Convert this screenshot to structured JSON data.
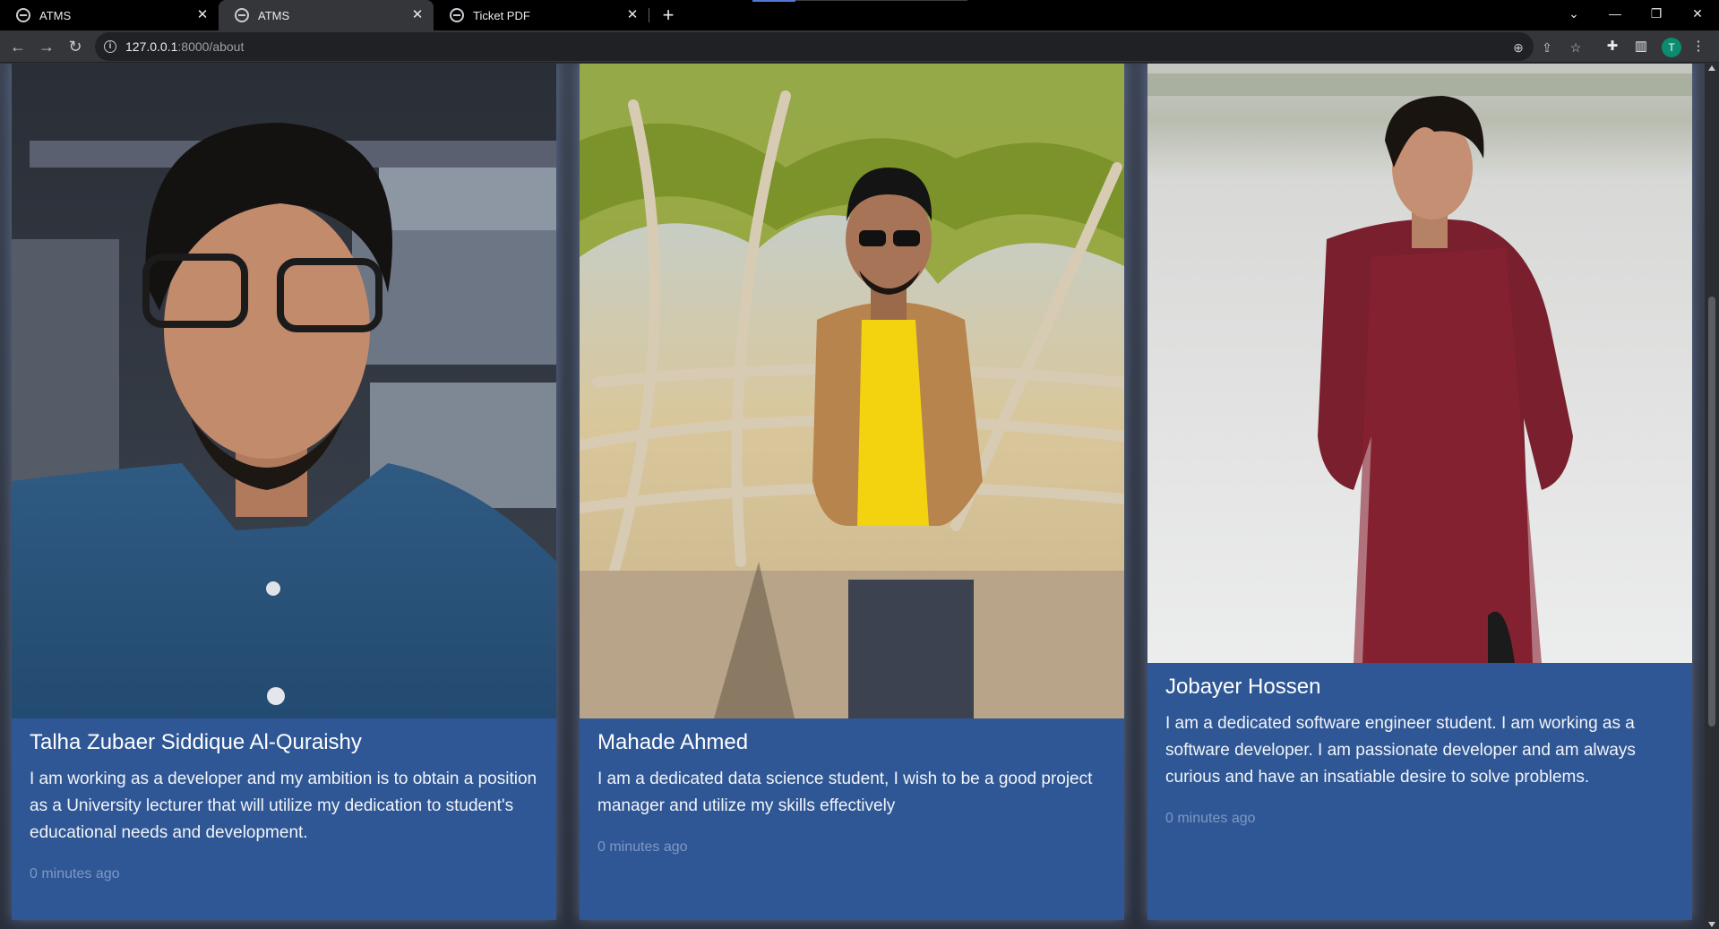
{
  "browser": {
    "tabs": [
      {
        "title": "ATMS",
        "active": false
      },
      {
        "title": "ATMS",
        "active": true
      },
      {
        "title": "Ticket PDF",
        "active": false
      }
    ],
    "new_tab_symbol": "+",
    "address": {
      "host": "127.0.0.1",
      "rest": ":8000/about"
    },
    "profile_initial": "T",
    "icons": [
      "back-icon",
      "forward-icon",
      "reload-icon",
      "info-icon",
      "zoom-icon",
      "share-icon",
      "star-icon",
      "extensions-icon",
      "side-panel-icon",
      "menu-icon",
      "tab-search-icon",
      "minimize-icon",
      "restore-icon",
      "close-icon"
    ]
  },
  "team": [
    {
      "name": "Talha Zubaer Siddique Al-Quraishy",
      "description": "I am working as a developer and my ambition is to obtain a position as a University lecturer that will utilize my dedication to student's educational needs and development.",
      "time": "0 minutes ago",
      "photo": "portrait-glasses-blue-shirt"
    },
    {
      "name": "Mahade Ahmed",
      "description": "I am a dedicated data science student, I wish to be a good project manager and utilize my skills effectively",
      "time": "0 minutes ago",
      "photo": "portrait-mangrove-forest"
    },
    {
      "name": "Jobayer Hossen",
      "description": "I am a dedicated software engineer student. I am working as a software developer. I am passionate developer and am always curious and have an insatiable desire to solve problems.",
      "time": "0 minutes ago",
      "photo": "portrait-river-maroon-kurta"
    }
  ],
  "colors": {
    "card": "#2f5795",
    "time_text": "#7f98c3",
    "chrome": "#35363a"
  }
}
